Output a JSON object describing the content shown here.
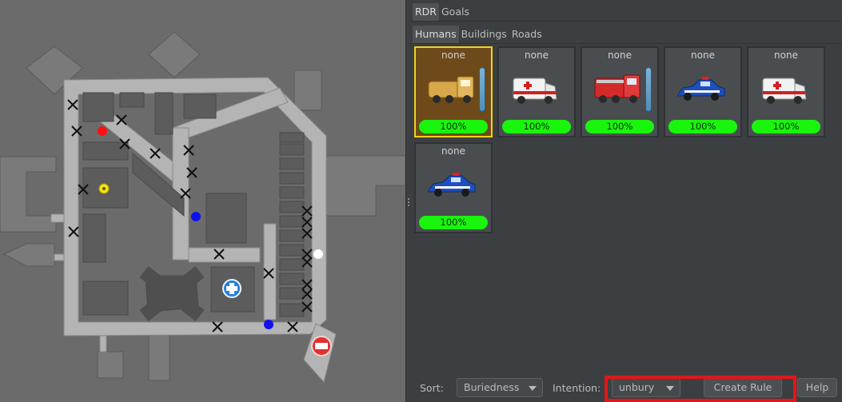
{
  "top_tabs": [
    {
      "label": "RDR"
    },
    {
      "label": "Goals"
    }
  ],
  "sub_tabs": [
    {
      "label": "Humans"
    },
    {
      "label": "Buildings"
    },
    {
      "label": "Roads"
    }
  ],
  "agents": [
    {
      "name": "none",
      "vehicle": "fire-tanker-icon",
      "health": "100%",
      "bar": true,
      "selected": true
    },
    {
      "name": "none",
      "vehicle": "ambulance-icon",
      "health": "100%",
      "bar": false,
      "selected": false
    },
    {
      "name": "none",
      "vehicle": "fire-truck-icon",
      "health": "100%",
      "bar": true,
      "selected": false
    },
    {
      "name": "none",
      "vehicle": "police-car-icon",
      "health": "100%",
      "bar": false,
      "selected": false
    },
    {
      "name": "none",
      "vehicle": "ambulance-icon",
      "health": "100%",
      "bar": false,
      "selected": false
    },
    {
      "name": "none",
      "vehicle": "police-car-icon",
      "health": "100%",
      "bar": false,
      "selected": false
    }
  ],
  "bottom": {
    "sort_label": "Sort:",
    "sort_value": "Buriedness",
    "intention_label": "Intention:",
    "intention_value": "unbury",
    "create_rule_label": "Create Rule",
    "help_label": "Help"
  },
  "colors": {
    "health_green": "#19f50c",
    "selected_border": "#f3d21c",
    "highlight_red": "#e3161a",
    "agent_red": "#ff1010",
    "agent_blue": "#1010ee",
    "agent_yellow": "#f2e21a",
    "agent_white": "#ffffff"
  }
}
